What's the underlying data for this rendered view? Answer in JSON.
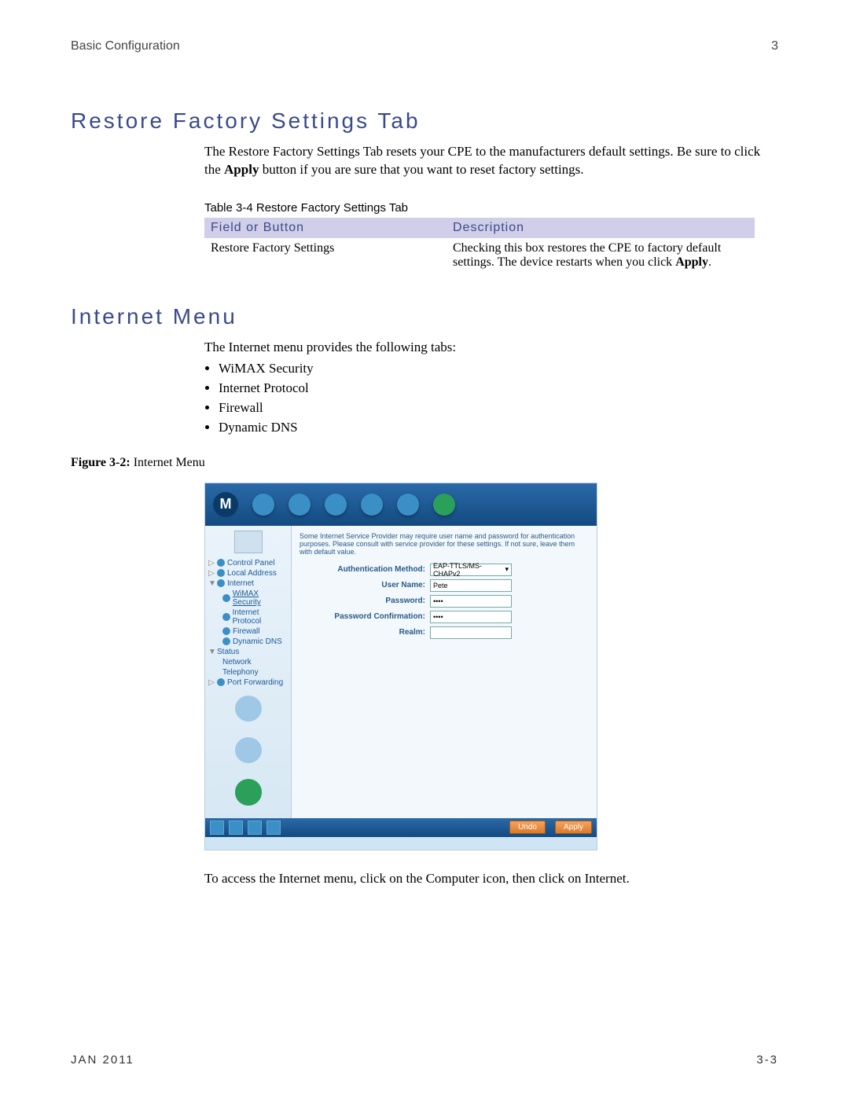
{
  "header": {
    "left": "Basic Configuration",
    "right": "3"
  },
  "section_restore": {
    "title": "Restore Factory Settings Tab",
    "para": "The Restore Factory Settings Tab resets your CPE to the manufacturers default settings. Be sure to click the Apply button if you are sure that you want to reset factory settings.",
    "table_caption": "Table 3-4 Restore Factory Settings Tab",
    "th1": "Field or Button",
    "th2": "Description",
    "row_field": "Restore Factory Settings",
    "row_desc": "Checking this box restores the CPE to factory default settings. The device restarts when you click Apply."
  },
  "section_internet": {
    "title": "Internet Menu",
    "intro": "The Internet menu provides the following tabs:",
    "tabs": [
      "WiMAX Security",
      "Internet Protocol",
      "Firewall",
      "Dynamic DNS"
    ],
    "figure_label": "Figure 3-2:",
    "figure_name": "Internet Menu",
    "after": "To access the Internet menu, click on the Computer icon, then click on Internet."
  },
  "screenshot": {
    "note": "Some Internet Service Provider may require user name and password for authentication purposes. Please consult with service provider for these settings. If not sure, leave them with default value.",
    "form": {
      "auth_label": "Authentication Method:",
      "auth_value": "EAP-TTLS/MS-CHAPv2",
      "user_label": "User Name:",
      "user_value": "Pete",
      "pass_label": "Password:",
      "pass_value": "••••",
      "conf_label": "Password Confirmation:",
      "conf_value": "••••",
      "realm_label": "Realm:",
      "realm_value": ""
    },
    "sidebar": {
      "items": [
        {
          "label": "Control Panel"
        },
        {
          "label": "Local Address"
        },
        {
          "label": "Internet"
        },
        {
          "label": "WiMAX Security"
        },
        {
          "label": "Internet Protocol"
        },
        {
          "label": "Firewall"
        },
        {
          "label": "Dynamic DNS"
        },
        {
          "label": "Status"
        },
        {
          "label": "Network"
        },
        {
          "label": "Telephony"
        },
        {
          "label": "Port Forwarding"
        }
      ]
    },
    "buttons": {
      "undo": "Undo",
      "apply": "Apply"
    }
  },
  "footer": {
    "left": "JAN 2011",
    "right": "3-3"
  }
}
